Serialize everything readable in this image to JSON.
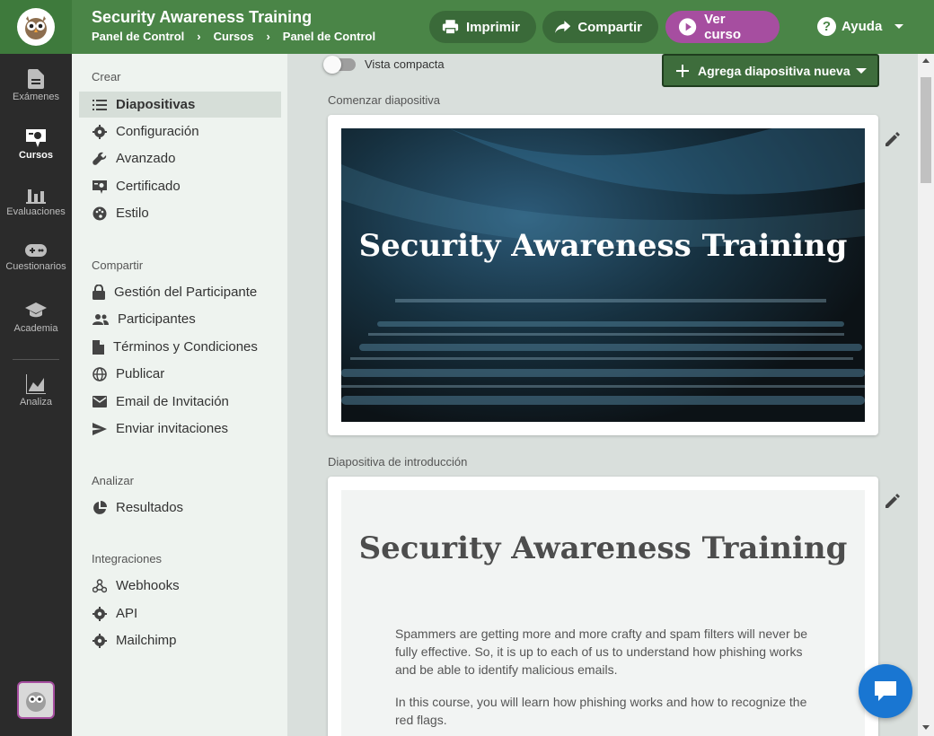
{
  "header": {
    "title": "Security Awareness Training",
    "breadcrumb": [
      "Panel de Control",
      "Cursos",
      "Panel de Control d"
    ],
    "print_label": "Imprimir",
    "share_label": "Compartir",
    "view_label": "Ver curso",
    "help_label": "Ayuda"
  },
  "rail": {
    "items": [
      {
        "label": "Exámenes",
        "icon": "document-icon"
      },
      {
        "label": "Cursos",
        "icon": "certificate-icon"
      },
      {
        "label": "Evaluaciones",
        "icon": "bar-chart-icon"
      },
      {
        "label": "Cuestionarios",
        "icon": "gamepad-icon"
      },
      {
        "label": "Academia",
        "icon": "graduation-cap-icon"
      },
      {
        "label": "Analiza",
        "icon": "area-chart-icon"
      }
    ],
    "active": "Cursos"
  },
  "sidemenu": {
    "sections": [
      {
        "label": "Crear",
        "items": [
          "Diapositivas",
          "Configuración",
          "Avanzado",
          "Certificado",
          "Estilo"
        ]
      },
      {
        "label": "Compartir",
        "items": [
          "Gestión del Participante",
          "Participantes",
          "Términos y Condiciones",
          "Publicar",
          "Email de Invitación",
          "Enviar invitaciones"
        ]
      },
      {
        "label": "Analizar",
        "items": [
          "Resultados"
        ]
      },
      {
        "label": "Integraciones",
        "items": [
          "Webhooks",
          "API",
          "Mailchimp"
        ]
      }
    ],
    "active_item": "Diapositivas"
  },
  "main": {
    "compact_view_label": "Vista compacta",
    "compact_view_on": false,
    "add_slide_label": "Agrega diapositiva nueva",
    "start_slide_label": "Comenzar diapositiva",
    "start_slide_title": "Security Awareness Training",
    "intro_slide_label": "Diapositiva de introducción",
    "intro_slide_title": "Security Awareness Training",
    "intro_paragraphs": [
      "Spammers are getting more and more crafty and spam filters will never be fully effective. So, it is up to each of us to understand how phishing works and be able to identify malicious emails.",
      "In this course, you will learn how phishing works and how to recognize the red flags."
    ]
  },
  "colors": {
    "header_green": "#4a8547",
    "header_dark_green": "#3a6a39",
    "view_button_purple": "#a64ea0",
    "rail_dark": "#2b2b2b",
    "sidemenu_bg": "#eef3ef",
    "chat_blue": "#1976d2"
  }
}
